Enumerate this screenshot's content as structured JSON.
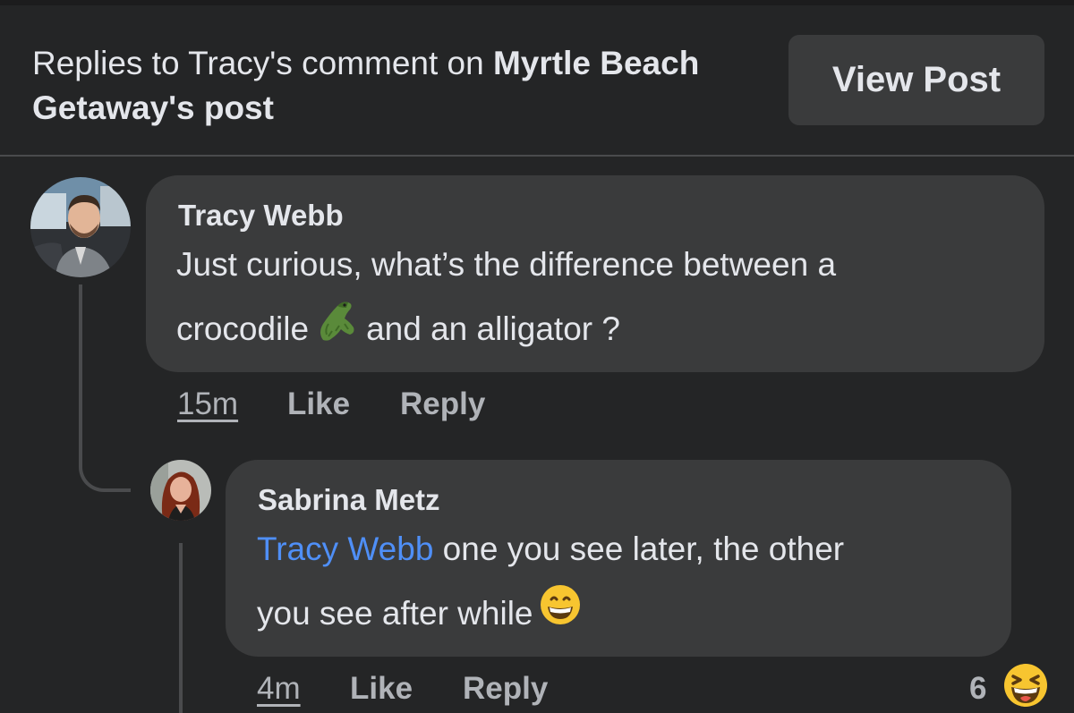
{
  "header": {
    "title_prefix": "Replies to Tracy's comment on ",
    "title_page_name": "Myrtle Beach Getaway",
    "title_suffix": "'s post",
    "view_post_label": "View Post"
  },
  "comments": [
    {
      "author": "Tracy Webb",
      "text_part1": "Just curious, what’s the difference between a",
      "text_part2a": "crocodile",
      "text_part2b": "and an alligator ?",
      "emoji": "crocodile-emoji",
      "timestamp": "15m",
      "like_label": "Like",
      "reply_label": "Reply"
    },
    {
      "author": "Sabrina Metz",
      "mention": "Tracy Webb",
      "text_part1": " one you see later, the other",
      "text_part2": "you see after while",
      "emoji": "grinning-face-emoji",
      "timestamp": "4m",
      "like_label": "Like",
      "reply_label": "Reply",
      "reaction_count": "6",
      "reaction_emoji": "laughing-squinting-face-emoji"
    }
  ],
  "colors": {
    "background": "#242526",
    "bubble": "#3a3b3c",
    "text": "#e4e6eb",
    "secondary_text": "#b0b3b8",
    "mention": "#4f8ff7"
  }
}
